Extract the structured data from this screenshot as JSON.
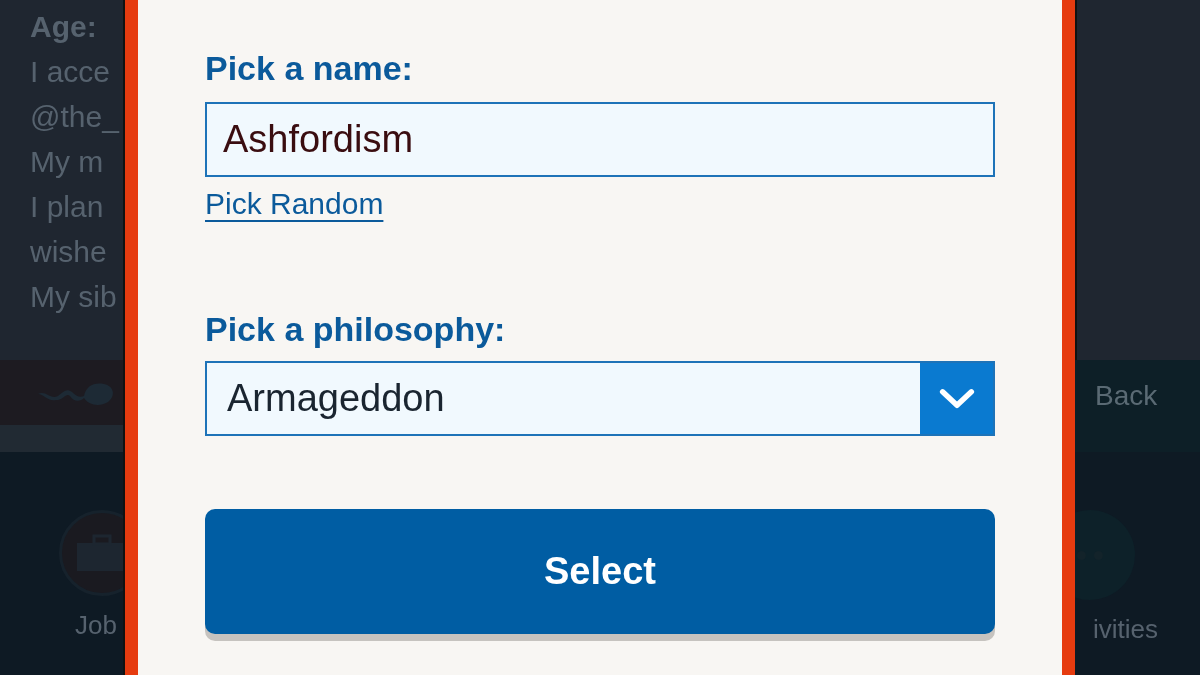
{
  "background": {
    "left_lines": [
      {
        "text": "Age:",
        "bold": true
      },
      {
        "text": "I acce",
        "bold": false
      },
      {
        "text": "@the_",
        "bold": false
      },
      {
        "text": "My m",
        "bold": false
      },
      {
        "text": "I plan",
        "bold": false
      },
      {
        "text": "wishe",
        "bold": false
      },
      {
        "text": "My sib",
        "bold": false
      }
    ],
    "back_button": "Back",
    "tabs": [
      {
        "label": "Job"
      },
      {
        "label": "ivities"
      }
    ]
  },
  "dialog": {
    "name_label": "Pick a name:",
    "name_value": "Ashfordism",
    "random_link": "Pick Random",
    "philosophy_label": "Pick a philosophy:",
    "philosophy_value": "Armageddon",
    "select_button": "Select"
  }
}
